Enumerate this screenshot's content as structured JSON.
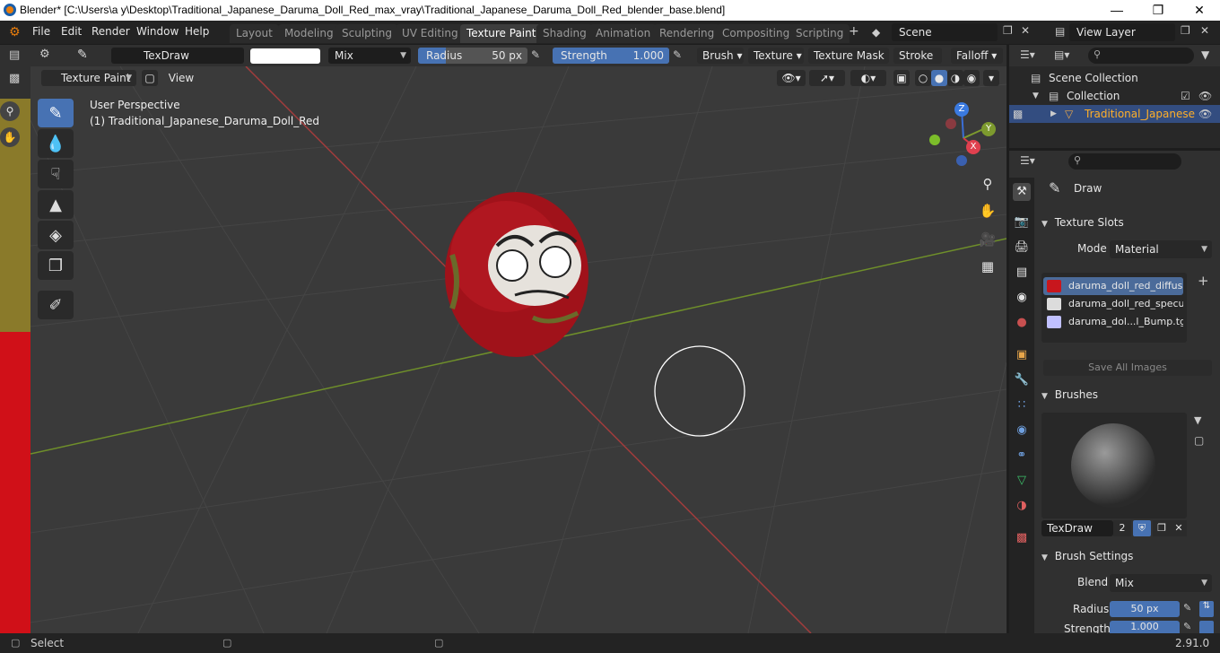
{
  "window": {
    "title": "Blender* [C:\\Users\\a y\\Desktop\\Traditional_Japanese_Daruma_Doll_Red_max_vray\\Traditional_Japanese_Daruma_Doll_Red_blender_base.blend]"
  },
  "menu": [
    "File",
    "Edit",
    "Render",
    "Window",
    "Help"
  ],
  "workspaces": [
    "Layout",
    "Modeling",
    "Sculpting",
    "UV Editing",
    "Texture Paint",
    "Shading",
    "Animation",
    "Rendering",
    "Compositing",
    "Scripting"
  ],
  "active_workspace": "Texture Paint",
  "scene_field": "Scene",
  "view_layer_field": "View Layer",
  "tool_header": {
    "brush_name": "TexDraw",
    "blend": "Mix",
    "radius_label": "Radius",
    "radius_value": "50 px",
    "strength_label": "Strength",
    "strength_value": "1.000",
    "strength_fill": 1.0,
    "radius_fill": 0.25,
    "menus": [
      "Brush",
      "Texture",
      "Texture Mask",
      "Stroke",
      "Falloff"
    ]
  },
  "viewport": {
    "mode": "Texture Paint",
    "view_btn": "View",
    "perspective_label": "User Perspective",
    "object_label": "(1) Traditional_Japanese_Daruma_Doll_Red",
    "gizmo": {
      "z": "Z",
      "y": "Y",
      "x": "X"
    }
  },
  "outliner": {
    "scene_collection": "Scene Collection",
    "collection": "Collection",
    "object": "Traditional_Japanese"
  },
  "properties": {
    "tool_name": "Draw",
    "texture_slots_title": "Texture Slots",
    "mode_label": "Mode",
    "mode_value": "Material",
    "slots": [
      {
        "name": "daruma_doll_red_diffus...",
        "color": "#c8161d"
      },
      {
        "name": "daruma_doll_red_specu...",
        "color": "#dcdcdc"
      },
      {
        "name": "daruma_dol...l_Bump.tga",
        "color": "#c0c0ff"
      }
    ],
    "save_all_images": "Save All Images",
    "brushes_title": "Brushes",
    "brush_name": "TexDraw",
    "brush_users": "2",
    "brush_settings_title": "Brush Settings",
    "blend_label": "Blend",
    "blend_value": "Mix",
    "radius_label": "Radius",
    "radius_value": "50 px",
    "strength_label": "Strength",
    "strength_value": "1.000"
  },
  "status": {
    "left": "Select",
    "version": "2.91.0"
  },
  "colors": {
    "accent": "#4772b3",
    "red_axis": "#a13c3c",
    "green_axis": "#6f8f2a"
  }
}
